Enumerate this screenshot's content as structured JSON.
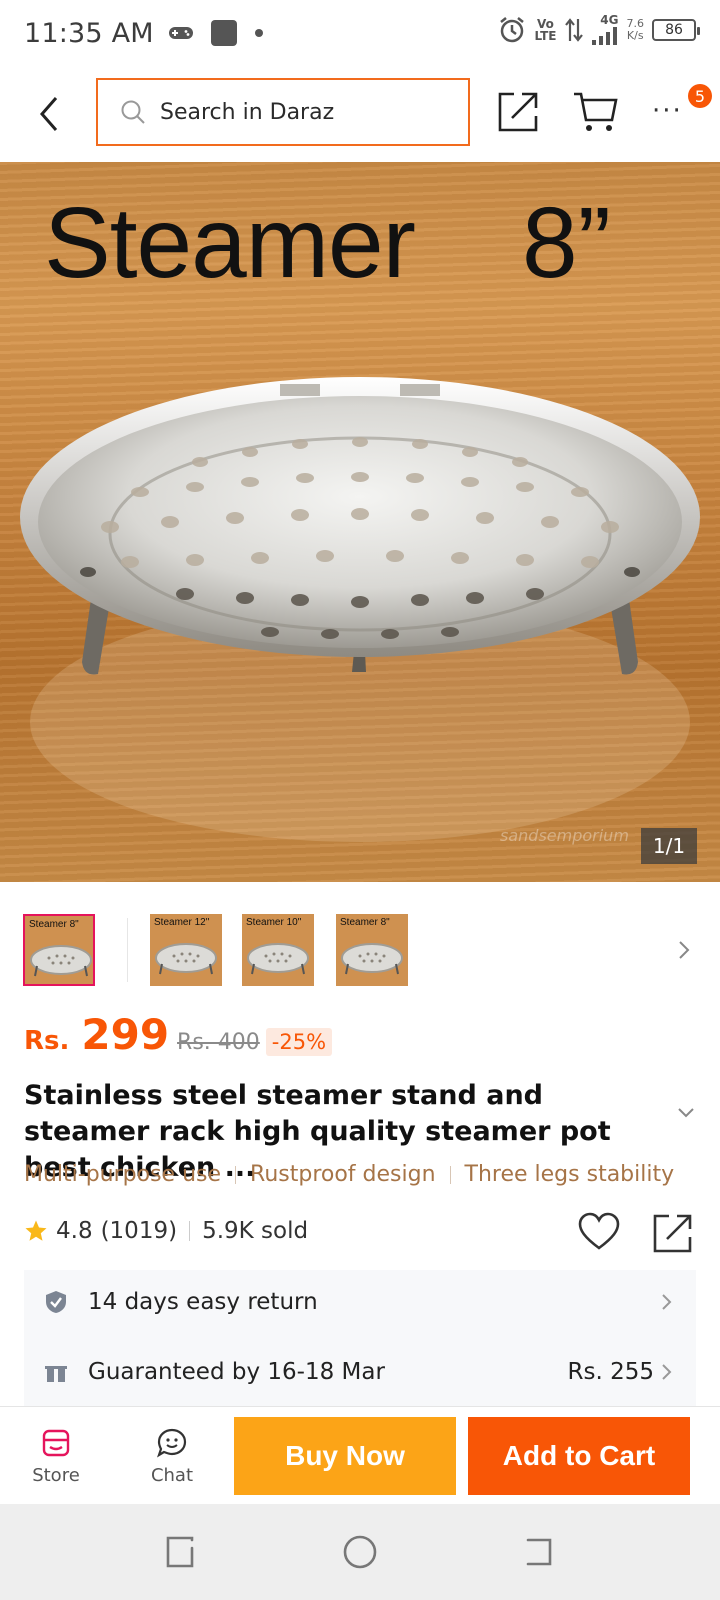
{
  "status_bar": {
    "time": "11:35 AM",
    "icons": [
      "gamepad-icon",
      "app-square-icon",
      "dot-icon",
      "alarm-icon"
    ],
    "volte": "Vo\nLTE",
    "network": "4G",
    "speed": "7.6\nK/s",
    "battery": "86"
  },
  "header": {
    "search_placeholder": "Search in Daraz",
    "cart_badge": "5"
  },
  "hero": {
    "title": "Steamer",
    "size": "8”",
    "counter": "1/1",
    "watermark": "sandsemporium"
  },
  "thumbnails": [
    {
      "label": "Steamer  8\"",
      "active": true
    },
    {
      "label": "Steamer  12\"",
      "active": false
    },
    {
      "label": "Steamer  10\"",
      "active": false
    },
    {
      "label": "Steamer   8\"",
      "active": false
    }
  ],
  "price": {
    "currency": "Rs.",
    "value": "299",
    "original": "Rs. 400",
    "discount": "-25%"
  },
  "product": {
    "title": "Stainless steel steamer stand and steamer rack high quality steamer pot best chicken ...",
    "features": [
      "Multi-purpose use",
      "Rustproof design",
      "Three legs stability"
    ]
  },
  "rating": {
    "score": "4.8",
    "count": "(1019)",
    "sold": "5.9K sold"
  },
  "services": [
    {
      "icon": "shield-check-icon",
      "text": "14 days easy return",
      "right": ""
    },
    {
      "icon": "delivery-truck-icon",
      "text": "Guaranteed by 16-18 Mar",
      "right": "Rs. 255"
    }
  ],
  "action_bar": {
    "store_label": "Store",
    "chat_label": "Chat",
    "buy_label": "Buy Now",
    "cart_label": "Add to Cart"
  },
  "colors": {
    "accent": "#f85606",
    "buy": "#fca417",
    "feature_text": "#a67447"
  }
}
